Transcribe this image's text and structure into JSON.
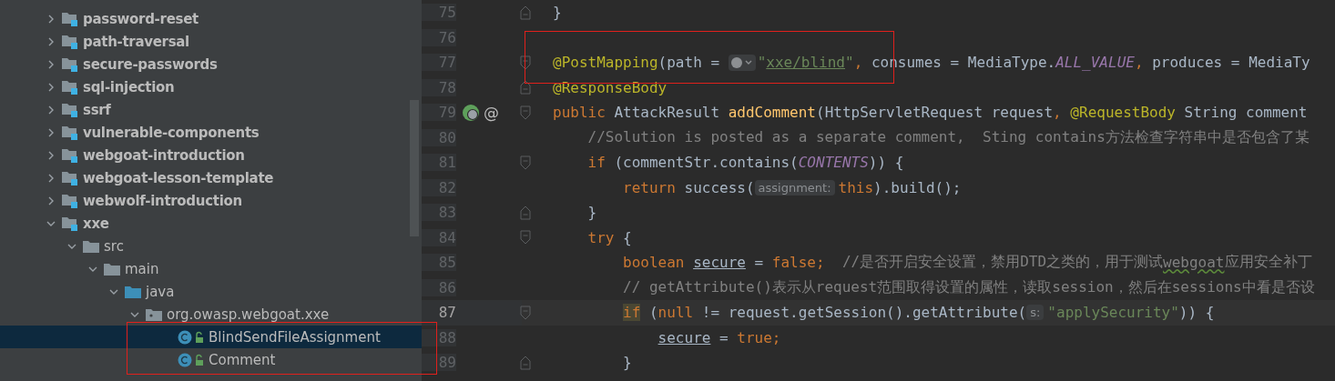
{
  "project_tree": {
    "items": [
      {
        "label": "password-reset",
        "kind": "module",
        "expanded": false,
        "selected": false
      },
      {
        "label": "path-traversal",
        "kind": "module",
        "expanded": false,
        "selected": false
      },
      {
        "label": "secure-passwords",
        "kind": "module",
        "expanded": false,
        "selected": false
      },
      {
        "label": "sql-injection",
        "kind": "module",
        "expanded": false,
        "selected": false
      },
      {
        "label": "ssrf",
        "kind": "module",
        "expanded": false,
        "selected": false
      },
      {
        "label": "vulnerable-components",
        "kind": "module",
        "expanded": false,
        "selected": false
      },
      {
        "label": "webgoat-introduction",
        "kind": "module",
        "expanded": false,
        "selected": false
      },
      {
        "label": "webgoat-lesson-template",
        "kind": "module",
        "expanded": false,
        "selected": false
      },
      {
        "label": "webwolf-introduction",
        "kind": "module",
        "expanded": false,
        "selected": false
      },
      {
        "label": "xxe",
        "kind": "module",
        "expanded": true,
        "selected": false,
        "children": [
          {
            "label": "src",
            "kind": "folder",
            "expanded": true,
            "selected": false,
            "children": [
              {
                "label": "main",
                "kind": "folder",
                "expanded": true,
                "selected": false,
                "children": [
                  {
                    "label": "java",
                    "kind": "source-root",
                    "expanded": true,
                    "selected": false,
                    "children": [
                      {
                        "label": "org.owasp.webgoat.xxe",
                        "kind": "package",
                        "expanded": true,
                        "selected": false,
                        "children": [
                          {
                            "label": "BlindSendFileAssignment",
                            "kind": "class",
                            "selected": true
                          },
                          {
                            "label": "Comment",
                            "kind": "class",
                            "selected": false
                          }
                        ]
                      }
                    ]
                  }
                ]
              }
            ]
          }
        ]
      }
    ]
  },
  "editor": {
    "lines": [
      {
        "number": "75",
        "current": false,
        "fold_close": true,
        "tokens": [
          {
            "kind": "plain",
            "text": "}"
          }
        ]
      },
      {
        "number": "76",
        "current": false
      },
      {
        "number": "77",
        "current": false,
        "fold_open": true,
        "tokens": [
          {
            "kind": "annotation",
            "text": "@PostMapping"
          },
          {
            "kind": "plain",
            "text": "(path = "
          },
          {
            "kind": "url-hint"
          },
          {
            "kind": "string",
            "text": "\""
          },
          {
            "kind": "link",
            "text": "xxe/blind"
          },
          {
            "kind": "string",
            "text": "\""
          },
          {
            "kind": "keyword",
            "text": ", "
          },
          {
            "kind": "plain",
            "text": "consumes = MediaType."
          },
          {
            "kind": "constant",
            "text": "ALL_VALUE"
          },
          {
            "kind": "keyword",
            "text": ", "
          },
          {
            "kind": "plain",
            "text": "produces = MediaTy"
          }
        ]
      },
      {
        "number": "78",
        "current": false,
        "fold_close": true,
        "tokens": [
          {
            "kind": "annotation",
            "text": "@ResponseBody"
          }
        ]
      },
      {
        "number": "79",
        "current": false,
        "fold_open": true,
        "gutter_icon": true,
        "gutter_mark": "@",
        "tokens": [
          {
            "kind": "keyword",
            "text": "public "
          },
          {
            "kind": "plain",
            "text": "AttackResult "
          },
          {
            "kind": "method",
            "text": "addComment"
          },
          {
            "kind": "plain",
            "text": "(HttpServletRequest request"
          },
          {
            "kind": "keyword",
            "text": ", "
          },
          {
            "kind": "annotation",
            "text": "@RequestBody "
          },
          {
            "kind": "plain",
            "text": "String comment"
          }
        ]
      },
      {
        "number": "80",
        "current": false,
        "tokens": [
          {
            "kind": "comment",
            "text": "    //Solution is posted as a separate comment,  Sting contains方法检查字符串中是否包含了某"
          }
        ]
      },
      {
        "number": "81",
        "current": false,
        "fold_open": true,
        "tokens": [
          {
            "kind": "keyword",
            "text": "    if "
          },
          {
            "kind": "plain",
            "text": "(commentStr.contains("
          },
          {
            "kind": "constant",
            "text": "CONTENTS"
          },
          {
            "kind": "plain",
            "text": ")) {"
          }
        ]
      },
      {
        "number": "82",
        "current": false,
        "tokens": [
          {
            "kind": "keyword",
            "text": "        return "
          },
          {
            "kind": "plain",
            "text": "success("
          },
          {
            "kind": "hint",
            "text": "assignment:"
          },
          {
            "kind": "keyword",
            "text": "this"
          },
          {
            "kind": "plain",
            "text": ").build();"
          }
        ]
      },
      {
        "number": "83",
        "current": false,
        "fold_close": true,
        "tokens": [
          {
            "kind": "plain",
            "text": "    }"
          }
        ]
      },
      {
        "number": "84",
        "current": false,
        "fold_open": true,
        "tokens": [
          {
            "kind": "keyword",
            "text": "    try "
          },
          {
            "kind": "plain",
            "text": "{"
          }
        ]
      },
      {
        "number": "85",
        "current": false,
        "tokens": [
          {
            "kind": "keyword",
            "text": "        boolean "
          },
          {
            "kind": "variable",
            "text": "secure"
          },
          {
            "kind": "plain",
            "text": " = "
          },
          {
            "kind": "keyword",
            "text": "false;"
          },
          {
            "kind": "comment",
            "text": "  //是否开启安全设置，禁用DTD之类的，用于测试"
          },
          {
            "kind": "typo",
            "text": "webgoat"
          },
          {
            "kind": "comment",
            "text": "应用安全补丁"
          }
        ]
      },
      {
        "number": "86",
        "current": false,
        "tokens": [
          {
            "kind": "comment",
            "text": "        // getAttribute()表示从request范围取得设置的属性，读取session，然后在sessions中看是否设"
          }
        ]
      },
      {
        "number": "87",
        "current": true,
        "fold_open": true,
        "tokens": [
          {
            "kind": "keyword-match",
            "text": "        if"
          },
          {
            "kind": "plain",
            "text": " ("
          },
          {
            "kind": "keyword",
            "text": "null "
          },
          {
            "kind": "plain",
            "text": "!= request.getSession().getAttribute("
          },
          {
            "kind": "hint",
            "text": "s:"
          },
          {
            "kind": "string",
            "text": "\"applySecurity\""
          },
          {
            "kind": "plain",
            "text": ")) {"
          }
        ]
      },
      {
        "number": "88",
        "current": false,
        "tokens": [
          {
            "kind": "variable",
            "text": "            secure"
          },
          {
            "kind": "plain",
            "text": " = "
          },
          {
            "kind": "keyword",
            "text": "true;"
          }
        ]
      },
      {
        "number": "89",
        "current": false,
        "fold_close": true,
        "tokens": [
          {
            "kind": "plain",
            "text": "        }"
          }
        ]
      }
    ]
  }
}
